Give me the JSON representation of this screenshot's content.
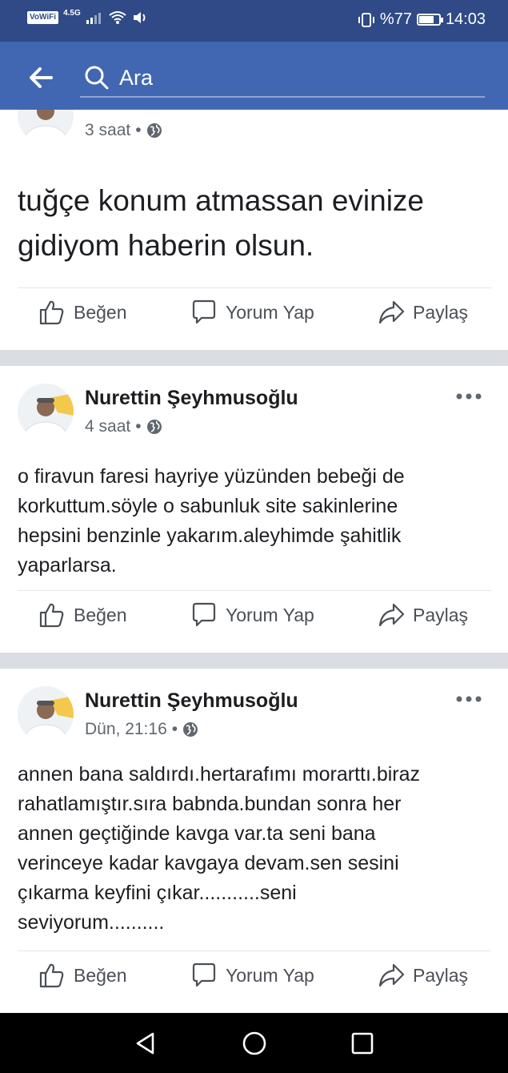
{
  "status_bar": {
    "volte": "VoWiFi",
    "network": "4.5G",
    "battery_text": "%77",
    "battery_level": 0.77,
    "time": "14:03"
  },
  "search": {
    "placeholder": "Ara"
  },
  "actions": {
    "like": "Beğen",
    "comment": "Yorum Yap",
    "share": "Paylaş"
  },
  "posts": [
    {
      "time": "3 saat",
      "text_lines": [
        "tuğçe konum atmassan evinize",
        "gidiyom haberin olsun."
      ]
    },
    {
      "author": "Nurettin Şeyhmusoğlu",
      "time": "4 saat",
      "text_lines": [
        "o firavun faresi hayriye yüzünden bebeği de",
        "korkuttum.söyle o sabunluk site sakinlerine",
        "hepsini benzinle yakarım.aleyhimde şahitlik",
        "yaparlarsa."
      ]
    },
    {
      "author": "Nurettin Şeyhmusoğlu",
      "time": "Dün, 21:16",
      "text_lines": [
        "annen bana saldırdı.hertarafımı morarttı.biraz",
        "rahatlamıştır.sıra babnda.bundan sonra her",
        "annen geçtiğinde kavga var.ta seni bana",
        "verinceye kadar kavgaya devam.sen sesini",
        "çıkarma keyfini çıkar...........seni",
        "seviyorum.........."
      ]
    }
  ],
  "icons": {
    "back": "arrow-left-icon",
    "search": "search-icon",
    "privacy": "globe-icon",
    "more": "more-dots-icon",
    "like": "thumbs-up-icon",
    "comment": "comment-icon",
    "share": "share-icon"
  },
  "colors": {
    "status_bar": "#2f4a86",
    "header": "#4267b2",
    "separator": "#dadde1",
    "text": "#1c1e21",
    "meta": "#606770"
  }
}
